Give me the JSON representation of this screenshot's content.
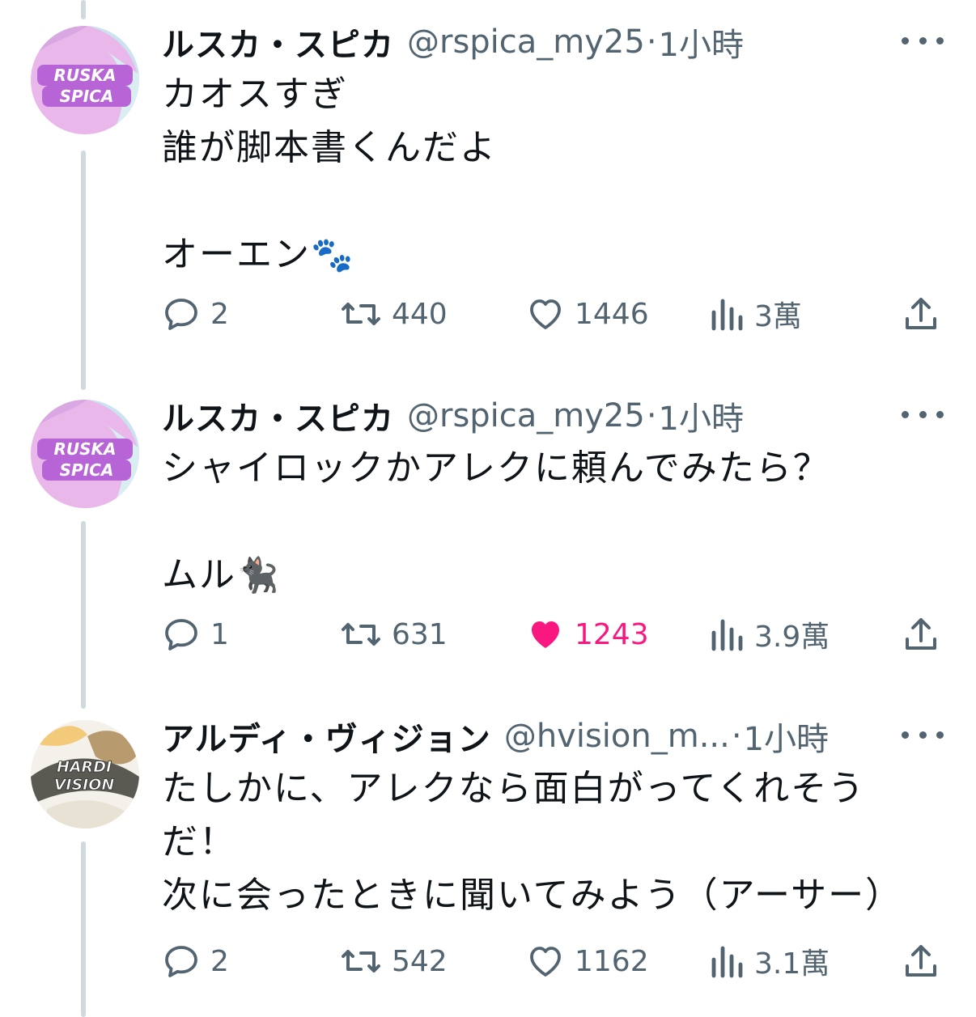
{
  "tweets": [
    {
      "display_name": "ルスカ・スピカ",
      "handle": "@rspica_my25",
      "separator": "·",
      "time": "1小時",
      "avatar_text": [
        "RUSKA",
        "SPICA"
      ],
      "text": "カオスすぎ\n誰が脚本書くんだよ\n\nオーエン",
      "emoji": "🐾",
      "replies": "2",
      "retweets": "440",
      "likes": "1446",
      "views": "3萬",
      "liked": false
    },
    {
      "display_name": "ルスカ・スピカ",
      "handle": "@rspica_my25",
      "separator": "·",
      "time": "1小時",
      "avatar_text": [
        "RUSKA",
        "SPICA"
      ],
      "text": "シャイロックかアレクに頼んでみたら？\n\nムル",
      "emoji": "🐈‍⬛",
      "replies": "1",
      "retweets": "631",
      "likes": "1243",
      "views": "3.9萬",
      "liked": true
    },
    {
      "display_name": "アルディ・ヴィジョン",
      "handle": "@hvision_m...",
      "separator": "·",
      "time": "1小時",
      "avatar_text": [
        "HARDI",
        "VISION"
      ],
      "text": "たしかに、アレクなら面白がってくれそう\nだ！\n次に会ったときに聞いてみよう（アーサー）",
      "emoji": "",
      "replies": "2",
      "retweets": "542",
      "likes": "1162",
      "views": "3.1萬",
      "liked": false
    }
  ],
  "colors": {
    "text": "#0f1419",
    "secondary": "#536471",
    "like_active": "#f91880",
    "thread_line": "#cfd9de"
  },
  "icons": [
    "reply-icon",
    "retweet-icon",
    "like-icon",
    "views-icon",
    "share-icon",
    "more-icon"
  ]
}
